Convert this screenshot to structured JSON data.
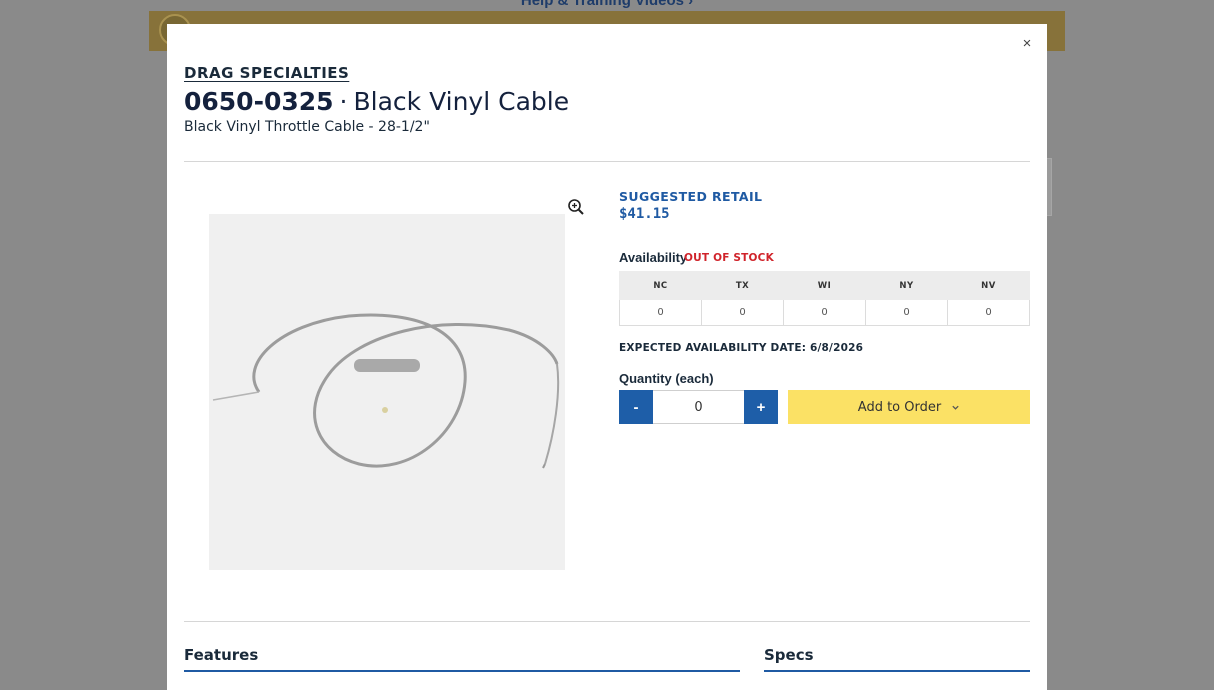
{
  "background": {
    "top_link": "Help & Training Videos ›"
  },
  "modal": {
    "close_label": "×",
    "brand": "DRAG SPECIALTIES",
    "part_number": "0650-0325",
    "separator": "·",
    "product_name": "Black Vinyl Cable",
    "subtitle": "Black Vinyl Throttle Cable - 28-1/2\"",
    "pricing": {
      "label": "SUGGESTED RETAIL",
      "price": "$41.15"
    },
    "availability": {
      "label": "Availability",
      "status": "OUT OF STOCK",
      "warehouses": [
        {
          "code": "NC",
          "qty": "0"
        },
        {
          "code": "TX",
          "qty": "0"
        },
        {
          "code": "WI",
          "qty": "0"
        },
        {
          "code": "NY",
          "qty": "0"
        },
        {
          "code": "NV",
          "qty": "0"
        }
      ],
      "expected_label": "EXPECTED AVAILABILITY DATE:",
      "expected_date": "6/8/2026"
    },
    "quantity": {
      "label": "Quantity (each)",
      "minus": "-",
      "plus": "+",
      "value": "0"
    },
    "add_to_order": "Add to Order",
    "sections": {
      "features": "Features",
      "specs": "Specs"
    }
  },
  "colors": {
    "accent_blue": "#1f5aa3",
    "button_blue": "#1e5ea8",
    "add_yellow": "#fbe165",
    "out_of_stock_red": "#d0232a"
  },
  "icons": {
    "zoom": "zoom-in-icon",
    "close": "close-icon",
    "dropdown": "chevron-down-icon"
  }
}
